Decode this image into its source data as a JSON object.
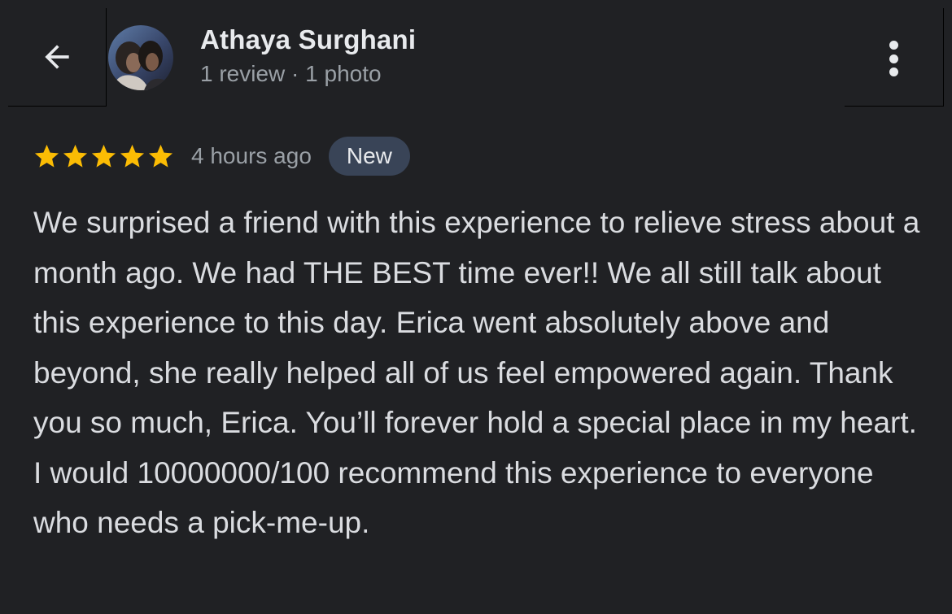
{
  "header": {
    "back_icon": "arrow-left-icon",
    "more_icon": "more-vert-icon",
    "author": {
      "name": "Athaya Surghani",
      "meta": "1 review · 1 photo"
    }
  },
  "review": {
    "rating": 5,
    "max_rating": 5,
    "star_color": "#fbbc04",
    "time_ago": "4 hours ago",
    "badge": "New",
    "text": "We surprised a friend with this experience to relieve stress about a month ago. We had THE BEST time ever!! We all still talk about this experience to this day. Erica went absolutely above and beyond, she really helped all of us feel empowered again. Thank you so much, Erica. You’ll forever hold a special place in my heart. I would 10000000/100 recommend this experience to everyone who needs a pick-me-up."
  },
  "colors": {
    "background": "#202124",
    "primary_text": "#e8eaed",
    "secondary_text": "#9aa0a6",
    "badge_background": "#394457"
  }
}
